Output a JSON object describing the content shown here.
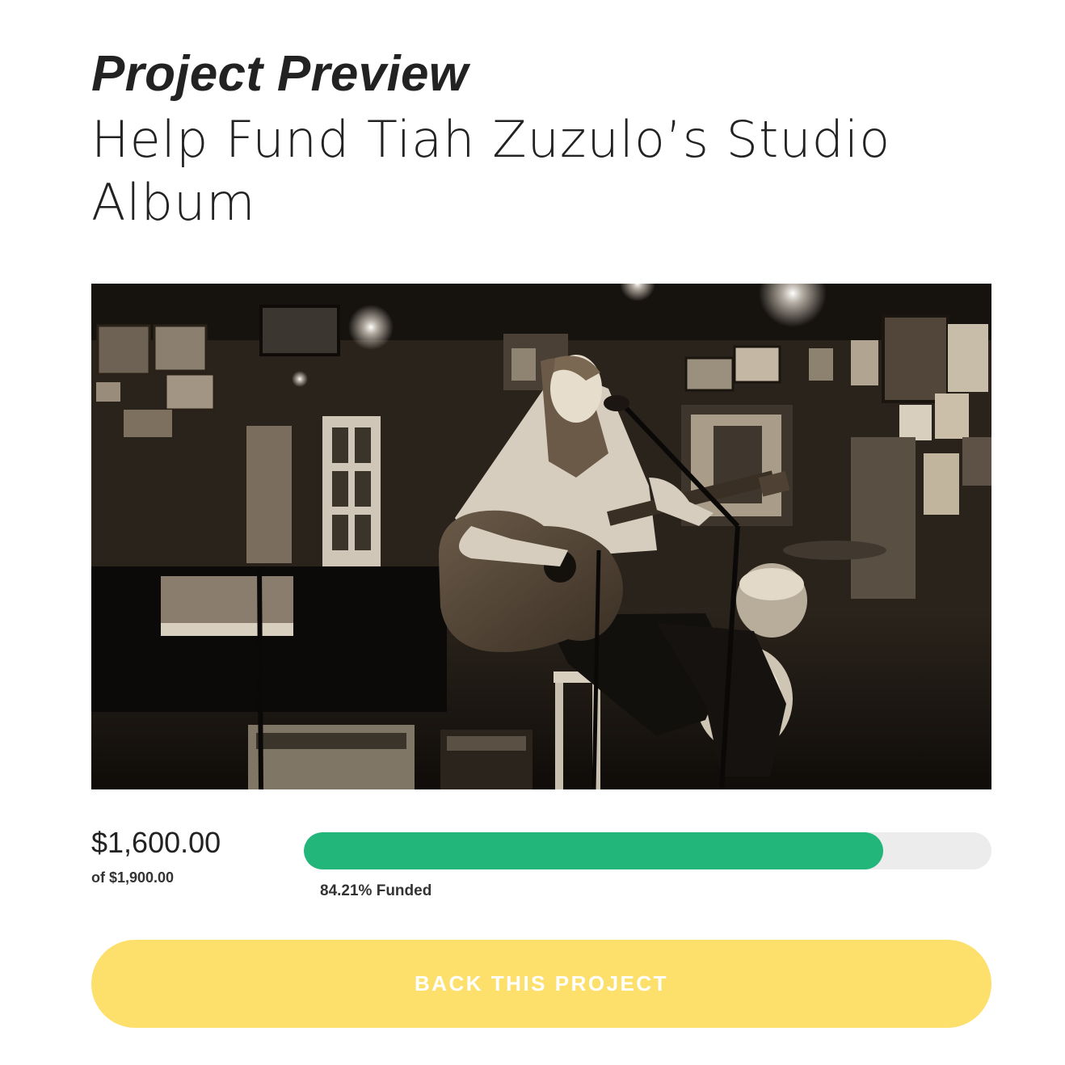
{
  "header": {
    "heading": "Project Preview",
    "title": "Help Fund Tiah Zuzulo’s Studio Album"
  },
  "image": {
    "icon": "guitarist-performance-photo"
  },
  "funding": {
    "raised": "$1,600.00",
    "goal": "of $1,900.00",
    "percent_label": "84.21% Funded",
    "progress": 0.8421
  },
  "cta": {
    "label": "BACK THIS PROJECT"
  },
  "colors": {
    "progress_fill": "#22b67a",
    "progress_track": "#ececec",
    "button": "#fde06b",
    "button_text": "#ffffff",
    "text": "#222222"
  }
}
